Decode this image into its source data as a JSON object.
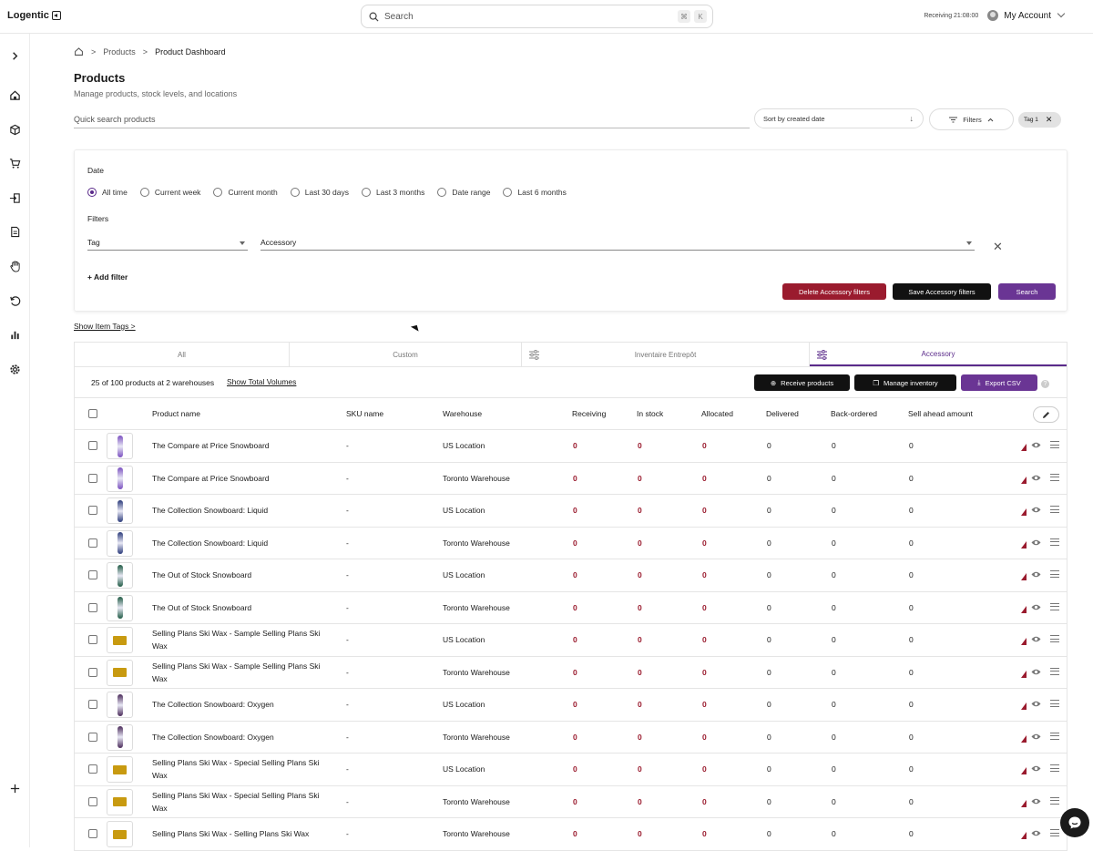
{
  "app": {
    "name": "Logentic"
  },
  "search": {
    "placeholder": "Search",
    "shortcut1": "⌘",
    "shortcut2": "K"
  },
  "topbar": {
    "receiving": "Receiving 21:08:00",
    "account": "My Account"
  },
  "breadcrumb": {
    "products": "Products",
    "current": "Product Dashboard"
  },
  "header": {
    "title": "Products",
    "subtitle": "Manage products, stock levels, and locations"
  },
  "toolbar": {
    "quick_search_placeholder": "Quick search products",
    "sort_label": "Sort by created date",
    "filters_label": "Filters",
    "tag_chip": "Tag 1"
  },
  "panel": {
    "date_label": "Date",
    "date_options": [
      "All time",
      "Current week",
      "Current month",
      "Last 30 days",
      "Last 3 months",
      "Date range",
      "Last 6 months"
    ],
    "selected_date": "All time",
    "filters_label": "Filters",
    "filter_field": "Tag",
    "filter_value": "Accessory",
    "add_filter": "+ Add filter",
    "delete_btn": "Delete Accessory filters",
    "save_btn": "Save Accessory filters",
    "search_btn": "Search"
  },
  "show_item_tags": "Show Item Tags >",
  "tabs": [
    {
      "label": "All"
    },
    {
      "label": "Custom"
    },
    {
      "label": "Inventaire Entrepôt"
    },
    {
      "label": "Accessory"
    }
  ],
  "table": {
    "count_text": "25 of 100 products at 2 warehouses",
    "show_total": "Show Total Volumes",
    "receive_btn": "Receive products",
    "manage_btn": "Manage inventory",
    "export_btn": "Export CSV",
    "columns": [
      "Product name",
      "SKU name",
      "Warehouse",
      "Receiving",
      "In stock",
      "Allocated",
      "Delivered",
      "Back-ordered",
      "Sell ahead amount"
    ],
    "rows": [
      {
        "name": "The Compare at Price Snowboard",
        "sku": "-",
        "warehouse": "US Location",
        "receiving": "0",
        "in_stock": "0",
        "allocated": "0",
        "delivered": "0",
        "back": "0",
        "sell": "0",
        "thumb": "board",
        "color": "#7a4fc0"
      },
      {
        "name": "The Compare at Price Snowboard",
        "sku": "-",
        "warehouse": "Toronto Warehouse",
        "receiving": "0",
        "in_stock": "0",
        "allocated": "0",
        "delivered": "0",
        "back": "0",
        "sell": "0",
        "thumb": "board",
        "color": "#7a4fc0"
      },
      {
        "name": "The Collection Snowboard: Liquid",
        "sku": "-",
        "warehouse": "US Location",
        "receiving": "0",
        "in_stock": "0",
        "allocated": "0",
        "delivered": "0",
        "back": "0",
        "sell": "0",
        "thumb": "board",
        "color": "#2a3a7a"
      },
      {
        "name": "The Collection Snowboard: Liquid",
        "sku": "-",
        "warehouse": "Toronto Warehouse",
        "receiving": "0",
        "in_stock": "0",
        "allocated": "0",
        "delivered": "0",
        "back": "0",
        "sell": "0",
        "thumb": "board",
        "color": "#2a3a7a"
      },
      {
        "name": "The Out of Stock Snowboard",
        "sku": "-",
        "warehouse": "US Location",
        "receiving": "0",
        "in_stock": "0",
        "allocated": "0",
        "delivered": "0",
        "back": "0",
        "sell": "0",
        "thumb": "board",
        "color": "#1f5a44"
      },
      {
        "name": "The Out of Stock Snowboard",
        "sku": "-",
        "warehouse": "Toronto Warehouse",
        "receiving": "0",
        "in_stock": "0",
        "allocated": "0",
        "delivered": "0",
        "back": "0",
        "sell": "0",
        "thumb": "board",
        "color": "#1f5a44"
      },
      {
        "name": "Selling Plans Ski Wax - Sample Selling Plans Ski Wax",
        "sku": "-",
        "warehouse": "US Location",
        "receiving": "0",
        "in_stock": "0",
        "allocated": "0",
        "delivered": "0",
        "back": "0",
        "sell": "0",
        "thumb": "wax",
        "color": "#c89a10"
      },
      {
        "name": "Selling Plans Ski Wax - Sample Selling Plans Ski Wax",
        "sku": "-",
        "warehouse": "Toronto Warehouse",
        "receiving": "0",
        "in_stock": "0",
        "allocated": "0",
        "delivered": "0",
        "back": "0",
        "sell": "0",
        "thumb": "wax",
        "color": "#c89a10"
      },
      {
        "name": "The Collection Snowboard: Oxygen",
        "sku": "-",
        "warehouse": "US Location",
        "receiving": "0",
        "in_stock": "0",
        "allocated": "0",
        "delivered": "0",
        "back": "0",
        "sell": "0",
        "thumb": "board",
        "color": "#4a2a5a"
      },
      {
        "name": "The Collection Snowboard: Oxygen",
        "sku": "-",
        "warehouse": "Toronto Warehouse",
        "receiving": "0",
        "in_stock": "0",
        "allocated": "0",
        "delivered": "0",
        "back": "0",
        "sell": "0",
        "thumb": "board",
        "color": "#4a2a5a"
      },
      {
        "name": "Selling Plans Ski Wax - Special Selling Plans Ski Wax",
        "sku": "-",
        "warehouse": "US Location",
        "receiving": "0",
        "in_stock": "0",
        "allocated": "0",
        "delivered": "0",
        "back": "0",
        "sell": "0",
        "thumb": "wax",
        "color": "#c89a10"
      },
      {
        "name": "Selling Plans Ski Wax - Special Selling Plans Ski Wax",
        "sku": "-",
        "warehouse": "Toronto Warehouse",
        "receiving": "0",
        "in_stock": "0",
        "allocated": "0",
        "delivered": "0",
        "back": "0",
        "sell": "0",
        "thumb": "wax",
        "color": "#c89a10"
      },
      {
        "name": "Selling Plans Ski Wax - Selling Plans Ski Wax",
        "sku": "-",
        "warehouse": "Toronto Warehouse",
        "receiving": "0",
        "in_stock": "0",
        "allocated": "0",
        "delivered": "0",
        "back": "0",
        "sell": "0",
        "thumb": "wax",
        "color": "#c89a10"
      }
    ]
  },
  "colors": {
    "accent": "#5a2a8a",
    "danger": "#9a1b2e",
    "dark": "#111111"
  }
}
